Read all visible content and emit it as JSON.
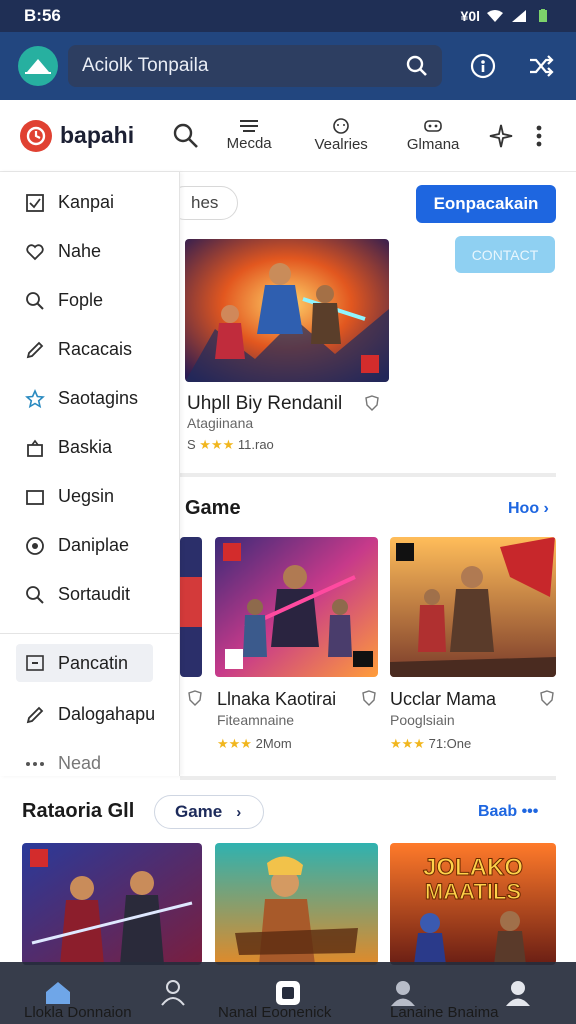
{
  "status_bar": {
    "time": "B:56",
    "right_text": "¥0l"
  },
  "app_bar": {
    "search_placeholder": "Aciolk Tonpaila"
  },
  "nav": {
    "brand": "bapahi",
    "tabs": [
      {
        "label": "Mecda"
      },
      {
        "label": "Vealries"
      },
      {
        "label": "Glmana"
      }
    ]
  },
  "drawer": {
    "items": [
      {
        "label": "Kanpai",
        "icon": "checkbox-icon"
      },
      {
        "label": "Nahe",
        "icon": "heart-outline-icon"
      },
      {
        "label": "Fople",
        "icon": "search-icon"
      },
      {
        "label": "Racacais",
        "icon": "pencil-icon"
      },
      {
        "label": "Saotagins",
        "icon": "star-icon"
      },
      {
        "label": "Baskia",
        "icon": "bag-icon"
      },
      {
        "label": "Uegsin",
        "icon": "square-icon"
      },
      {
        "label": "Daniplae",
        "icon": "target-icon"
      },
      {
        "label": "Sortaudit",
        "icon": "search-icon"
      }
    ],
    "active_item": "Pancatin",
    "bottom_items": [
      {
        "label": "Dalogahapu",
        "icon": "pencil-icon"
      },
      {
        "label": "Nead",
        "icon": "more-icon"
      }
    ]
  },
  "filters": {
    "pill": "hes",
    "primary_button": "Eonpacakain",
    "secondary_button": "CONTACT"
  },
  "featured": {
    "title": "Uhpll Biy Rendanil",
    "subtitle": "Atagiinana",
    "rating_prefix": "S",
    "stars": "★★★",
    "rating_text": "11.rao"
  },
  "section_game": {
    "title": "Game",
    "link": "Hoo",
    "cards": [
      {
        "title": "Llnaka Kaotirai",
        "subtitle": "Fiteamnaine",
        "stars": "★★★",
        "rating_text": "2Mom"
      },
      {
        "title": "Ucclar Mama",
        "subtitle": "Pooglsiain",
        "stars": "★★★",
        "rating_text": "71:One"
      }
    ]
  },
  "section_rataoria": {
    "title": "Rataoria Gll",
    "pill": "Game",
    "link": "Baab",
    "card_art_text": [
      "JOLAKO",
      "MAATILS"
    ]
  },
  "bottom_nav": {
    "items": [
      {
        "icon": "home-icon",
        "label": "Llokla Donnaion"
      },
      {
        "icon": "person-icon",
        "label": ""
      },
      {
        "icon": "square-frame-icon",
        "label": "Nanal Eoonenick"
      },
      {
        "icon": "avatar-icon",
        "label": ""
      },
      {
        "icon": "profile-icon",
        "label": "Lanaine Bnaima"
      }
    ]
  },
  "colors": {
    "app_bar": "#22467f",
    "accent_blue": "#1e66e0",
    "star": "#f1b61e",
    "brand_red": "#e04132"
  }
}
